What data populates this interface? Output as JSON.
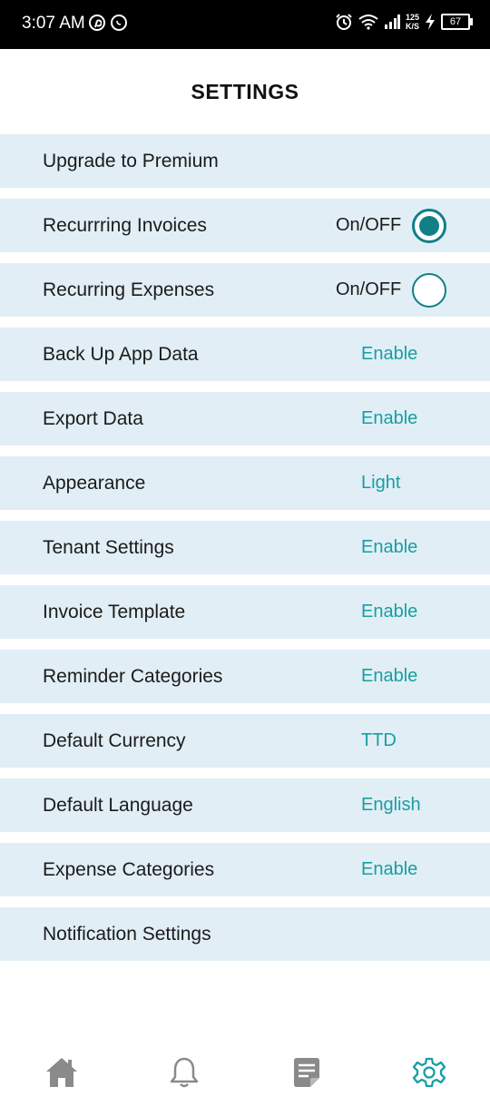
{
  "status_bar": {
    "time": "3:07 AM",
    "net_speed_value": "125",
    "net_speed_unit": "K/S",
    "battery": "67",
    "icons": [
      "pinterest-icon",
      "whatsapp-icon",
      "alarm-icon",
      "wifi-icon",
      "signal-icon",
      "charging-icon",
      "battery-icon"
    ]
  },
  "header": {
    "title": "SETTINGS"
  },
  "settings": [
    {
      "label": "Upgrade to Premium",
      "value": null,
      "type": "link"
    },
    {
      "label": "Recurrring Invoices",
      "value": "On/OFF",
      "type": "toggle",
      "on": true
    },
    {
      "label": "Recurring Expenses",
      "value": "On/OFF",
      "type": "toggle",
      "on": false
    },
    {
      "label": "Back Up App Data",
      "value": "Enable",
      "type": "value"
    },
    {
      "label": "Export Data",
      "value": "Enable",
      "type": "value"
    },
    {
      "label": "Appearance",
      "value": "Light",
      "type": "value"
    },
    {
      "label": "Tenant Settings",
      "value": "Enable",
      "type": "value"
    },
    {
      "label": "Invoice Template",
      "value": "Enable",
      "type": "value"
    },
    {
      "label": "Reminder Categories",
      "value": "Enable",
      "type": "value"
    },
    {
      "label": "Default Currency",
      "value": "TTD",
      "type": "value"
    },
    {
      "label": "Default Language",
      "value": "English",
      "type": "value"
    },
    {
      "label": "Expense Categories",
      "value": "Enable",
      "type": "value"
    },
    {
      "label": "Notification Settings",
      "value": null,
      "type": "link"
    }
  ],
  "bottom_nav": [
    {
      "icon": "home-icon",
      "active": false
    },
    {
      "icon": "bell-icon",
      "active": false
    },
    {
      "icon": "notes-icon",
      "active": false
    },
    {
      "icon": "gear-icon",
      "active": true
    }
  ],
  "colors": {
    "accent": "#169fa3",
    "toggle": "#117f86",
    "row_background": "#e1eef5",
    "nav_inactive": "#8a8a8a"
  }
}
